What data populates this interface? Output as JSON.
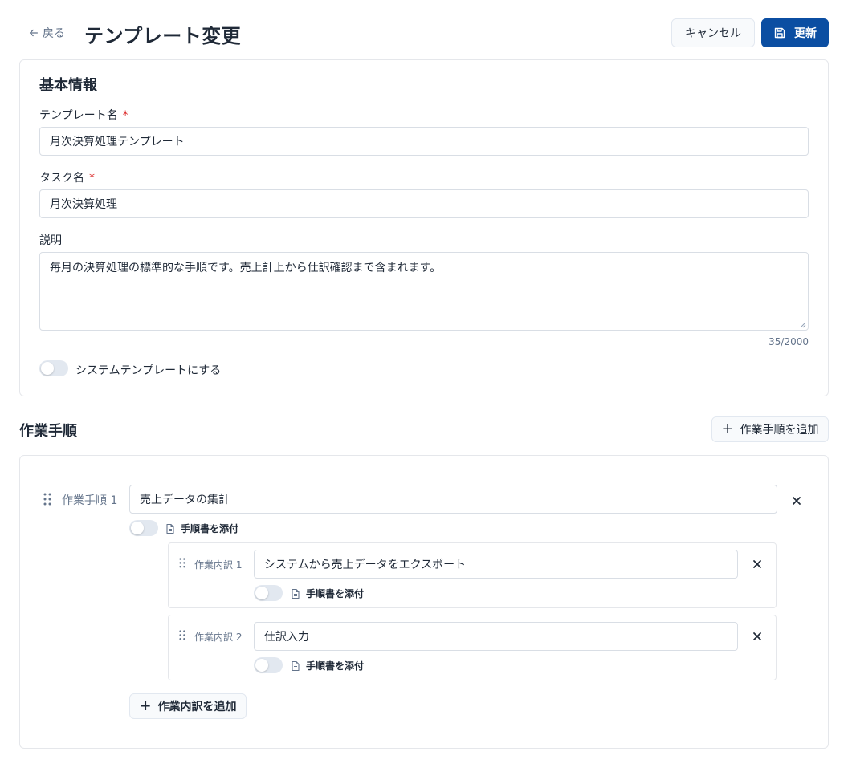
{
  "header": {
    "back_label": "戻る",
    "title": "テンプレート変更",
    "cancel_label": "キャンセル",
    "update_label": "更新"
  },
  "basic_info": {
    "title": "基本情報",
    "template_name": {
      "label": "テンプレート名",
      "required": "*",
      "value": "月次決算処理テンプレート"
    },
    "task_name": {
      "label": "タスク名",
      "required": "*",
      "value": "月次決算処理"
    },
    "description": {
      "label": "説明",
      "value": "毎月の決算処理の標準的な手順です。売上計上から仕訳確認まで含まれます。",
      "counter": "35/2000"
    },
    "system_template_toggle": {
      "label": "システムテンプレートにする",
      "on": false
    }
  },
  "steps": {
    "title": "作業手順",
    "add_step_label": "作業手順を追加",
    "items": [
      {
        "label": "作業手順 1",
        "value": "売上データの集計",
        "attach_label": "手順書を添付",
        "attach_on": false,
        "sub_items": [
          {
            "label": "作業内訳 1",
            "value": "システムから売上データをエクスポート",
            "attach_label": "手順書を添付",
            "attach_on": false
          },
          {
            "label": "作業内訳 2",
            "value": "仕訳入力",
            "attach_label": "手順書を添付",
            "attach_on": false
          }
        ],
        "add_sub_label": "作業内訳を追加"
      }
    ]
  },
  "colors": {
    "primary": "#0b4ea2",
    "required": "#dc2626",
    "muted_text": "#64748b",
    "border": "#e5e7eb"
  }
}
